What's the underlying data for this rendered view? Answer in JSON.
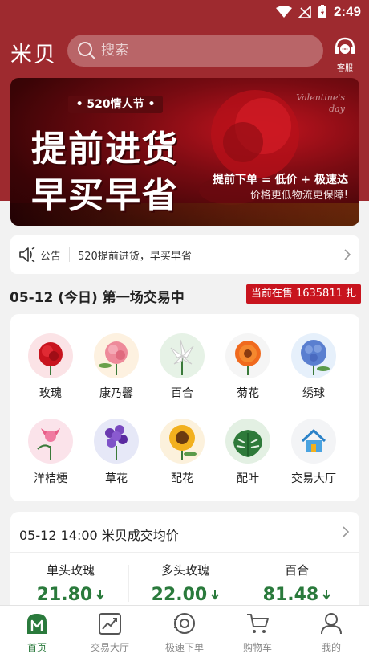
{
  "status_bar": {
    "time": "2:49"
  },
  "header": {
    "logo": "米贝",
    "search_placeholder": "搜索",
    "service_label": "客服"
  },
  "banner": {
    "tag": "• 520情人节 •",
    "line1": "提前进货",
    "line2": "早买早省",
    "sub1": "提前下单 = 低价 + 极速达",
    "sub2": "价格更低物流更保障!",
    "script1": "Valentine's",
    "script2": "day"
  },
  "notice": {
    "title": "公告",
    "text": "520提前进货，早买早省"
  },
  "session": {
    "title": "05-12 (今日) 第一场交易中",
    "on_sale": "当前在售 1635811 扎"
  },
  "categories": [
    {
      "label": "玫瑰",
      "icon": "rose-icon",
      "bg": "#fbe3e6"
    },
    {
      "label": "康乃馨",
      "icon": "carnation-icon",
      "bg": "#fdf1e0"
    },
    {
      "label": "百合",
      "icon": "lily-icon",
      "bg": "#e6f2e6"
    },
    {
      "label": "菊花",
      "icon": "chrysanthemum-icon",
      "bg": "#f5f5f5"
    },
    {
      "label": "绣球",
      "icon": "hydrangea-icon",
      "bg": "#e6f0fb"
    },
    {
      "label": "洋桔梗",
      "icon": "eustoma-icon",
      "bg": "#fbe3ea"
    },
    {
      "label": "草花",
      "icon": "flower-grass-icon",
      "bg": "#e6e8f7"
    },
    {
      "label": "配花",
      "icon": "sunflower-icon",
      "bg": "#fcf1dc"
    },
    {
      "label": "配叶",
      "icon": "monstera-leaf-icon",
      "bg": "#e3f0e3"
    },
    {
      "label": "交易大厅",
      "icon": "house-icon",
      "bg": "#f3f4f6"
    }
  ],
  "price": {
    "title": "05-12 14:00 米贝成交均价",
    "items": [
      {
        "name": "单头玫瑰",
        "value": "21.80"
      },
      {
        "name": "多头玫瑰",
        "value": "22.00"
      },
      {
        "name": "百合",
        "value": "81.48"
      }
    ]
  },
  "tabs": [
    {
      "label": "首页",
      "icon": "home-icon"
    },
    {
      "label": "交易大厅",
      "icon": "trend-chart-icon"
    },
    {
      "label": "极速下单",
      "icon": "quick-order-icon"
    },
    {
      "label": "购物车",
      "icon": "cart-icon"
    },
    {
      "label": "我的",
      "icon": "user-icon"
    }
  ],
  "colors": {
    "brand_red": "#9e2a2f",
    "sale_red": "#c8141e",
    "price_green": "#2a7a3c"
  }
}
